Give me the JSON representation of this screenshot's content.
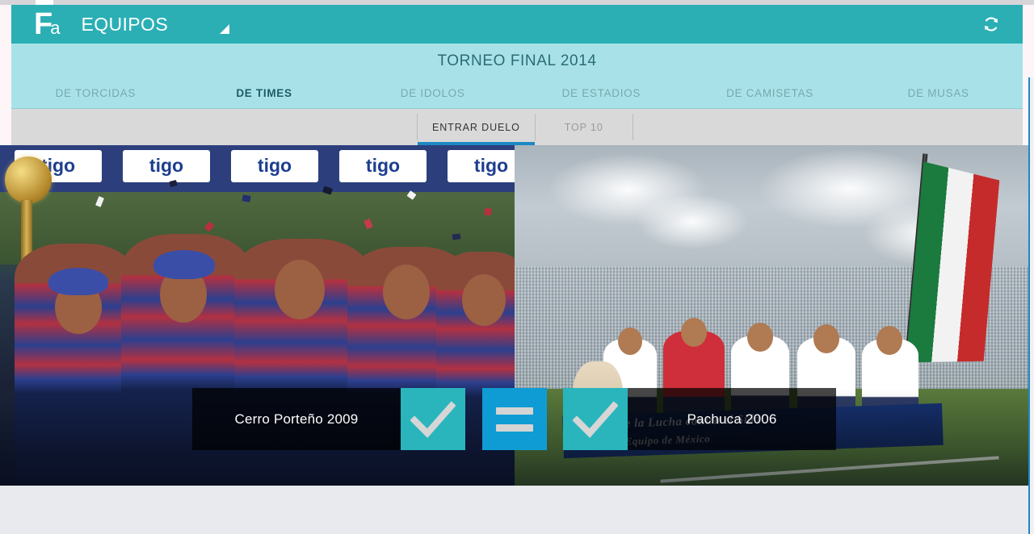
{
  "app": {
    "logo_main": "F",
    "logo_sub": "a",
    "title": "EQUIPOS",
    "resize_handle_icon": "resize-triangle-icon",
    "refresh_icon": "refresh-icon"
  },
  "tournament": {
    "title": "TORNEO FINAL 2014"
  },
  "main_tabs": [
    {
      "label": "DE TORCIDAS",
      "active": false
    },
    {
      "label": "DE TIMES",
      "active": true
    },
    {
      "label": "DE IDOLOS",
      "active": false
    },
    {
      "label": "DE ESTADIOS",
      "active": false
    },
    {
      "label": "DE CAMISETAS",
      "active": false
    },
    {
      "label": "DE MUSAS",
      "active": false
    }
  ],
  "sub_tabs": [
    {
      "label": "ENTRAR DUELO",
      "active": true
    },
    {
      "label": "TOP 10",
      "active": false
    }
  ],
  "duel": {
    "left": {
      "team_label": "Cerro Porteño 2009",
      "photo_alt": "team-celebration-photo",
      "vote_icon": "check-icon"
    },
    "right": {
      "team_label": "Pachuca 2006",
      "photo_alt": "stadium-team-photo",
      "vote_icon": "check-icon"
    },
    "tie": {
      "icon": "equals-icon"
    }
  },
  "photo_details": {
    "left_sponsor_text": "tigo",
    "right_banner_line1": "Mundial de la Lucha contra el Sida",
    "right_banner_line2": "Pachuca el Equipo de México"
  },
  "colors": {
    "header_teal": "#2bafb5",
    "title_bar_cyan": "#a8e2e8",
    "sub_tab_gray": "#d9d9d9",
    "accent_blue": "#1e88c4",
    "vote_teal": "#2ab5bd",
    "tie_blue": "#0f9cd4",
    "page_bg": "#e8eaed"
  }
}
